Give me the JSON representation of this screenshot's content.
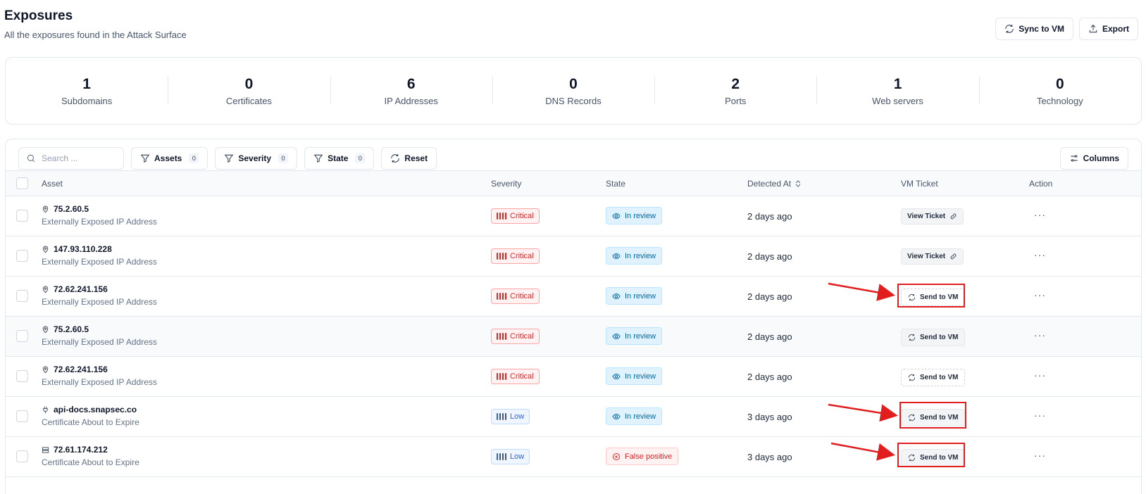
{
  "header": {
    "title": "Exposures",
    "subtitle": "All the exposures found in the Attack Surface",
    "sync_label": "Sync to VM",
    "export_label": "Export"
  },
  "stats": [
    {
      "value": "1",
      "label": "Subdomains"
    },
    {
      "value": "0",
      "label": "Certificates"
    },
    {
      "value": "6",
      "label": "IP Addresses"
    },
    {
      "value": "0",
      "label": "DNS Records"
    },
    {
      "value": "2",
      "label": "Ports"
    },
    {
      "value": "1",
      "label": "Web servers"
    },
    {
      "value": "0",
      "label": "Technology"
    }
  ],
  "toolbar": {
    "search_placeholder": "Search ...",
    "filters": [
      {
        "label": "Assets",
        "count": "0"
      },
      {
        "label": "Severity",
        "count": "0"
      },
      {
        "label": "State",
        "count": "0"
      }
    ],
    "reset_label": "Reset",
    "columns_label": "Columns"
  },
  "columns": {
    "asset": "Asset",
    "severity": "Severity",
    "state": "State",
    "detected": "Detected At",
    "vm_ticket": "VM Ticket",
    "action": "Action"
  },
  "rows": [
    {
      "asset": "75.2.60.5",
      "icon": "map-pin-icon",
      "type": "Externally Exposed IP Address",
      "severity": "Critical",
      "state": "In review",
      "detected": "2 days ago",
      "vm": "View Ticket",
      "vm_kind": "view"
    },
    {
      "asset": "147.93.110.228",
      "icon": "map-pin-icon",
      "type": "Externally Exposed IP Address",
      "severity": "Critical",
      "state": "In review",
      "detected": "2 days ago",
      "vm": "View Ticket",
      "vm_kind": "view"
    },
    {
      "asset": "72.62.241.156",
      "icon": "map-pin-icon",
      "type": "Externally Exposed IP Address",
      "severity": "Critical",
      "state": "In review",
      "detected": "2 days ago",
      "vm": "Send to VM",
      "vm_kind": "send-dashed"
    },
    {
      "asset": "75.2.60.5",
      "icon": "map-pin-icon",
      "type": "Externally Exposed IP Address",
      "severity": "Critical",
      "state": "In review",
      "detected": "2 days ago",
      "vm": "Send to VM",
      "vm_kind": "send"
    },
    {
      "asset": "72.62.241.156",
      "icon": "map-pin-icon",
      "type": "Externally Exposed IP Address",
      "severity": "Critical",
      "state": "In review",
      "detected": "2 days ago",
      "vm": "Send to VM",
      "vm_kind": "send-dashed"
    },
    {
      "asset": "api-docs.snapsec.co",
      "icon": "plug-icon",
      "type": "Certificate About to Expire",
      "severity": "Low",
      "state": "In review",
      "detected": "3 days ago",
      "vm": "Send to VM",
      "vm_kind": "send"
    },
    {
      "asset": "72.61.174.212",
      "icon": "server-icon",
      "type": "Certificate About to Expire",
      "severity": "Low",
      "state": "False positive",
      "detected": "3 days ago",
      "vm": "Send to VM",
      "vm_kind": "send"
    }
  ],
  "action_glyph": "···",
  "colors": {
    "critical": "#dc2626",
    "low": "#2563eb",
    "review": "#0369a1",
    "annotation": "#e11d1d"
  }
}
